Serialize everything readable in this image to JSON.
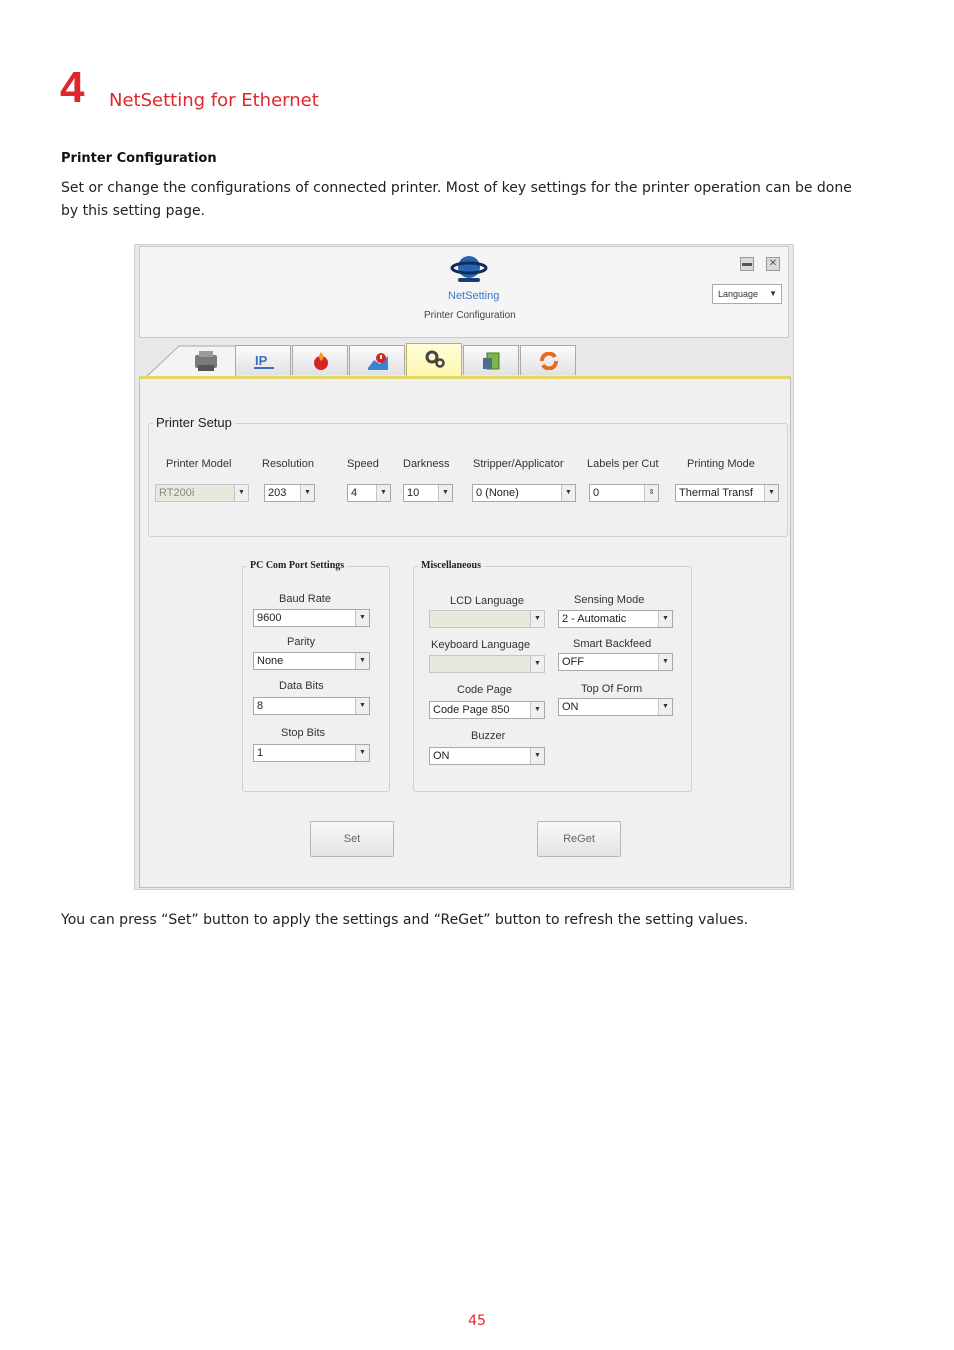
{
  "chapter": {
    "number": "4",
    "title": "NetSetting for Ethernet"
  },
  "section": {
    "heading": "Printer Configuration"
  },
  "paragraphs": {
    "intro": "Set or change the configurations of connected printer. Most of key settings for the printer operation can be done by this setting page.",
    "outro": "You can press “Set” button to apply the settings and “ReGet” button to refresh the setting values."
  },
  "page_number": "45",
  "app": {
    "name": "NetSetting",
    "subtitle": "Printer Configuration",
    "language_label": "Language",
    "tabs": [
      {
        "icon": "printer-icon"
      },
      {
        "icon": "ip-network-icon",
        "label": "IP"
      },
      {
        "icon": "fire-icon"
      },
      {
        "icon": "alert-icon"
      },
      {
        "icon": "gears-icon",
        "active": true
      },
      {
        "icon": "file-icon"
      },
      {
        "icon": "refresh-icon"
      }
    ],
    "printer_setup": {
      "title": "Printer Setup",
      "printer_model": {
        "label": "Printer Model",
        "value": "RT200i"
      },
      "resolution": {
        "label": "Resolution",
        "value": "203"
      },
      "speed": {
        "label": "Speed",
        "value": "4"
      },
      "darkness": {
        "label": "Darkness",
        "value": "10"
      },
      "stripper": {
        "label": "Stripper/Applicator",
        "value": "0 (None)"
      },
      "labels_per_cut": {
        "label": "Labels per Cut",
        "value": "0"
      },
      "printing_mode": {
        "label": "Printing Mode",
        "value": "Thermal Transf"
      }
    },
    "com_port": {
      "title": "PC Com Port Settings",
      "baud_rate": {
        "label": "Baud Rate",
        "value": "9600"
      },
      "parity": {
        "label": "Parity",
        "value": "None"
      },
      "data_bits": {
        "label": "Data Bits",
        "value": "8"
      },
      "stop_bits": {
        "label": "Stop Bits",
        "value": "1"
      }
    },
    "misc": {
      "title": "Miscellaneous",
      "lcd_language": {
        "label": "LCD Language",
        "value": ""
      },
      "keyboard_language": {
        "label": "Keyboard Language",
        "value": ""
      },
      "code_page": {
        "label": "Code Page",
        "value": "Code Page 850"
      },
      "buzzer": {
        "label": "Buzzer",
        "value": "ON"
      },
      "sensing_mode": {
        "label": "Sensing Mode",
        "value": "2 - Automatic"
      },
      "smart_backfeed": {
        "label": "Smart Backfeed",
        "value": "OFF"
      },
      "top_of_form": {
        "label": "Top Of Form",
        "value": "ON"
      }
    },
    "buttons": {
      "set": "Set",
      "reget": "ReGet"
    }
  }
}
